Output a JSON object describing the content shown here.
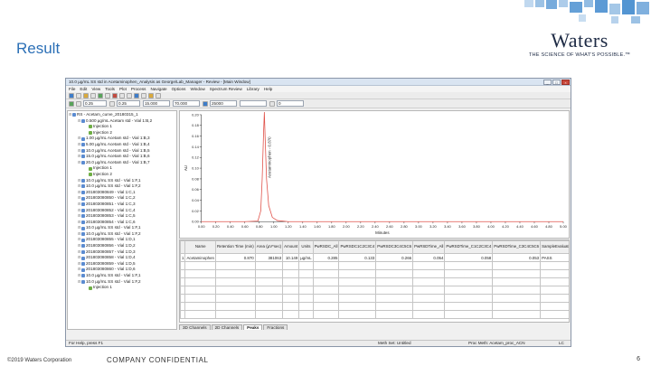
{
  "slide": {
    "title": "Result",
    "logo_word": "Waters",
    "logo_tagline": "THE SCIENCE OF WHAT'S POSSIBLE.™",
    "copyright": "©2019 Waters Corporation",
    "confidential": "COMPANY CONFIDENTIAL",
    "page_number": "6",
    "accent_color": "#2b6fb6"
  },
  "app": {
    "window_title": "10.0 µg/mL SS std in Acetaminophen_Analysis as George/Lab_Manager - Review - [Main Window]",
    "menu": [
      "File",
      "Edit",
      "View",
      "Tools",
      "Plot",
      "Process",
      "Navigate",
      "Options",
      "Window",
      "Spectrum Review",
      "Library",
      "Help"
    ],
    "toolbar_fields": [
      "0.25",
      "0.25",
      "15.000",
      "70.000",
      "25000",
      "0"
    ],
    "tree": [
      {
        "label": "RS - Acetam_curve_20180315_1",
        "level": 0,
        "type": "folder"
      },
      {
        "label": "0.500 µg/mL Acetam std - Vial 1:B,2",
        "level": 1,
        "type": "sample"
      },
      {
        "label": "Injection 1",
        "level": 2,
        "type": "injection"
      },
      {
        "label": "Injection 2",
        "level": 2,
        "type": "injection"
      },
      {
        "label": "1.00 µg/mL Acetam std - Vial 1:B,3",
        "level": 1,
        "type": "sample"
      },
      {
        "label": "5.00 µg/mL Acetam std - Vial 1:B,4",
        "level": 1,
        "type": "sample"
      },
      {
        "label": "10.0 µg/mL Acetam std - Vial 1:B,5",
        "level": 1,
        "type": "sample"
      },
      {
        "label": "15.0 µg/mL Acetam std - Vial 1:B,6",
        "level": 1,
        "type": "sample"
      },
      {
        "label": "20.0 µg/mL Acetam std - Vial 1:B,7",
        "level": 1,
        "type": "sample"
      },
      {
        "label": "Injection 1",
        "level": 2,
        "type": "injection"
      },
      {
        "label": "Injection 2",
        "level": 2,
        "type": "injection"
      },
      {
        "label": "10.0 µg/mL SS std - Vial 1:F,1",
        "level": 1,
        "type": "sample"
      },
      {
        "label": "10.0 µg/mL SS std - Vial 1:F,2",
        "level": 1,
        "type": "sample"
      },
      {
        "label": "201803080849 - Vial 1:C,1",
        "level": 1,
        "type": "sample"
      },
      {
        "label": "201803080850 - Vial 1:C,2",
        "level": 1,
        "type": "sample"
      },
      {
        "label": "201803080851 - Vial 1:C,3",
        "level": 1,
        "type": "sample"
      },
      {
        "label": "201803080852 - Vial 1:C,4",
        "level": 1,
        "type": "sample"
      },
      {
        "label": "201803080853 - Vial 1:C,5",
        "level": 1,
        "type": "sample"
      },
      {
        "label": "201803080854 - Vial 1:C,6",
        "level": 1,
        "type": "sample"
      },
      {
        "label": "10.0 µg/mL SS std - Vial 1:F,1",
        "level": 1,
        "type": "sample"
      },
      {
        "label": "10.0 µg/mL SS std - Vial 1:F,2",
        "level": 1,
        "type": "sample"
      },
      {
        "label": "201803080855 - Vial 1:D,1",
        "level": 1,
        "type": "sample"
      },
      {
        "label": "201803080856 - Vial 1:D,2",
        "level": 1,
        "type": "sample"
      },
      {
        "label": "201803080857 - Vial 1:D,3",
        "level": 1,
        "type": "sample"
      },
      {
        "label": "201803080858 - Vial 1:D,4",
        "level": 1,
        "type": "sample"
      },
      {
        "label": "201803080859 - Vial 1:D,5",
        "level": 1,
        "type": "sample"
      },
      {
        "label": "201803080860 - Vial 1:D,6",
        "level": 1,
        "type": "sample"
      },
      {
        "label": "10.0 µg/mL SS std - Vial 1:F,1",
        "level": 1,
        "type": "sample"
      },
      {
        "label": "10.0 µg/mL SS std - Vial 1:F,2",
        "level": 1,
        "type": "sample"
      },
      {
        "label": "Injection 1",
        "level": 2,
        "type": "injection"
      }
    ],
    "results_table": {
      "headers": [
        "",
        "Name",
        "Retention Time (min)",
        "Area (µV*sec)",
        "Amount",
        "Units",
        "PwRSDC_All",
        "PwRSDC1C2C3C4",
        "PwRSDC3C4C5C6",
        "PwRSDTime_All",
        "PwRSDTime_C1C2C3C4",
        "PwRSDTime_C3C4C5C6",
        "SampleEvaluation"
      ],
      "rows": [
        [
          "1",
          "Acetaminophen",
          "0.870",
          "381063",
          "10.149",
          "µg/mL",
          "0.285",
          "0.133",
          "0.266",
          "0.054",
          "0.058",
          "0.053",
          "PASS"
        ]
      ]
    },
    "tabs": [
      "3D Channels",
      "2D Channels",
      "Peaks",
      "Fractions"
    ],
    "active_tab": "Peaks",
    "status": {
      "left": "For Help, press F1",
      "middle": "Meth Set: Untitled",
      "right": "Proc Meth: Acetam_proc_ACN",
      "corner": "LC"
    }
  },
  "chart_data": {
    "type": "line",
    "title": "",
    "xlabel": "Minutes",
    "ylabel": "AU",
    "xlim": [
      0.0,
      5.0
    ],
    "ylim": [
      0.0,
      0.2
    ],
    "x_ticks": [
      "0.00",
      "0.20",
      "0.40",
      "0.60",
      "0.80",
      "1.00",
      "1.20",
      "1.40",
      "1.60",
      "1.80",
      "2.00",
      "2.20",
      "2.40",
      "2.60",
      "2.80",
      "3.00",
      "3.20",
      "3.40",
      "3.60",
      "3.80",
      "4.00",
      "4.20",
      "4.40",
      "4.60",
      "4.80",
      "5.00"
    ],
    "y_ticks": [
      "0.20",
      "0.18",
      "0.16",
      "0.14",
      "0.12",
      "0.10",
      "0.08",
      "0.06",
      "0.04",
      "0.02",
      "0.00"
    ],
    "series": [
      {
        "x": [
          0.0,
          0.6,
          0.78,
          0.82,
          0.84,
          0.86,
          0.87,
          0.88,
          0.9,
          0.93,
          0.98,
          1.05,
          1.2,
          5.0
        ],
        "y": [
          0.0,
          0.0,
          0.001,
          0.02,
          0.08,
          0.17,
          0.205,
          0.16,
          0.08,
          0.03,
          0.008,
          0.002,
          0.0,
          0.0
        ],
        "color": "#e0524a"
      }
    ],
    "annotations": [
      {
        "x": 0.87,
        "text": "Acetaminophen - 0.870"
      }
    ],
    "grid": false,
    "legend": "none"
  }
}
